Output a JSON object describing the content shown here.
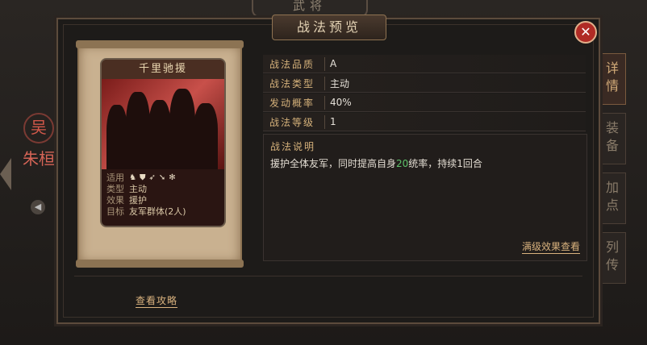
{
  "top_tab": "武将",
  "left_panel": {
    "faction": "吴",
    "general_name": "朱桓"
  },
  "side_tabs": [
    {
      "label": "详情",
      "active": true
    },
    {
      "label": "装备",
      "active": false
    },
    {
      "label": "加点",
      "active": false
    },
    {
      "label": "列传",
      "active": false
    }
  ],
  "dialog": {
    "title": "战法预览",
    "close_icon": "close-icon"
  },
  "card": {
    "name": "千里驰援",
    "rows": [
      {
        "key": "适用",
        "icons": [
          "cavalry-icon",
          "shield-icon",
          "bow-icon",
          "spear-icon",
          "wheel-icon"
        ]
      },
      {
        "key": "类型",
        "value": "主动"
      },
      {
        "key": "效果",
        "value": "援护"
      },
      {
        "key": "目标",
        "value": "友军群体(2人)"
      }
    ]
  },
  "attributes": [
    {
      "key": "战法品质",
      "value": "A"
    },
    {
      "key": "战法类型",
      "value": "主动"
    },
    {
      "key": "发动概率",
      "value": "40%"
    },
    {
      "key": "战法等级",
      "value": "1"
    }
  ],
  "description": {
    "title": "战法说明",
    "text_before": "援护全体友军，同时提高自身",
    "highlight": "20",
    "text_after": "统率，持续1回合",
    "highlight_color": "#5ec26a"
  },
  "max_effect_link": "满级效果查看",
  "guide_link": "查看攻略"
}
